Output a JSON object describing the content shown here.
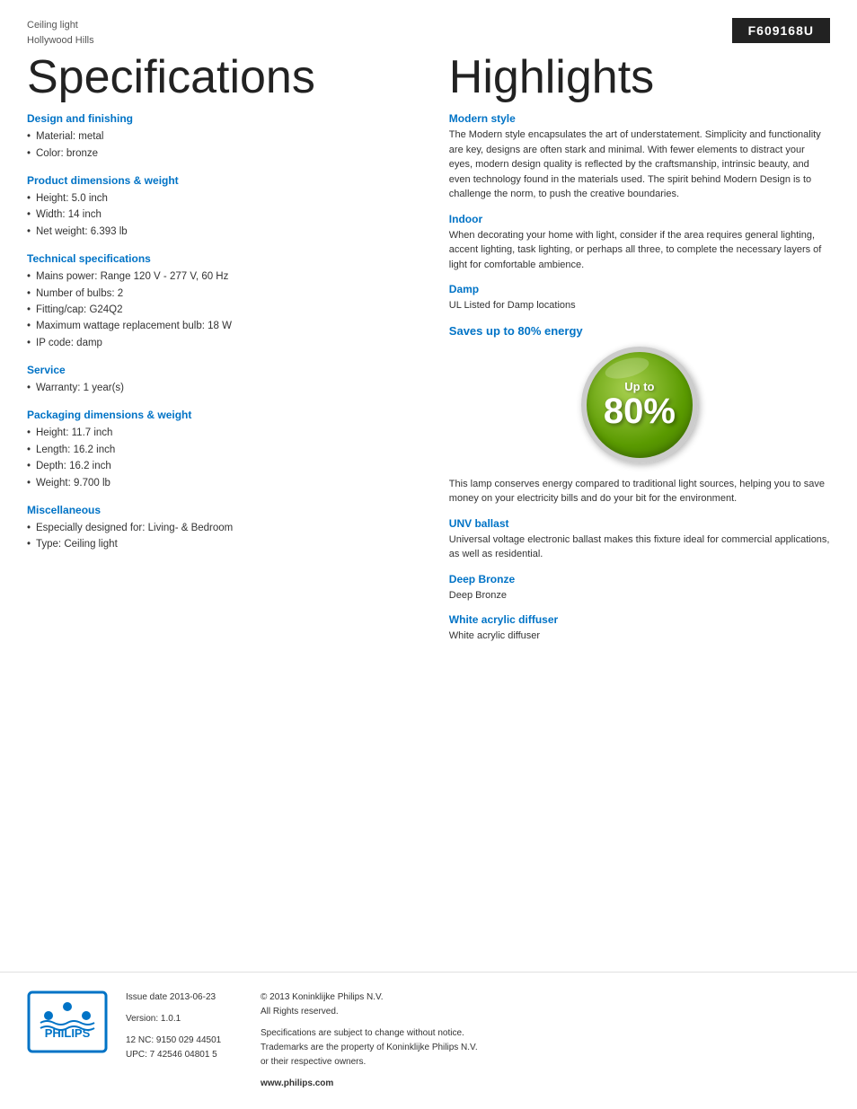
{
  "header": {
    "product_category": "Ceiling light",
    "product_name": "Hollywood Hills",
    "model_number": "F609168U"
  },
  "specs_page_title": "Specifications",
  "highlights_page_title": "Highlights",
  "sections": {
    "design": {
      "title": "Design and finishing",
      "items": [
        "Material: metal",
        "Color: bronze"
      ]
    },
    "product_dimensions": {
      "title": "Product dimensions & weight",
      "items": [
        "Height: 5.0 inch",
        "Width: 14 inch",
        "Net weight: 6.393 lb"
      ]
    },
    "technical": {
      "title": "Technical specifications",
      "items": [
        "Mains power: Range 120 V - 277 V, 60 Hz",
        "Number of bulbs: 2",
        "Fitting/cap: G24Q2",
        "Maximum wattage replacement bulb: 18 W",
        "IP code: damp"
      ]
    },
    "service": {
      "title": "Service",
      "items": [
        "Warranty: 1 year(s)"
      ]
    },
    "packaging": {
      "title": "Packaging dimensions & weight",
      "items": [
        "Height: 11.7 inch",
        "Length: 16.2 inch",
        "Depth: 16.2 inch",
        "Weight: 9.700 lb"
      ]
    },
    "miscellaneous": {
      "title": "Miscellaneous",
      "items": [
        "Especially designed for: Living- & Bedroom",
        "Type: Ceiling light"
      ]
    }
  },
  "highlights": {
    "modern_style": {
      "title": "Modern style",
      "text": "The Modern style encapsulates the art of understatement. Simplicity and functionality are key, designs are often stark and minimal. With fewer elements to distract your eyes, modern design quality is reflected by the craftsmanship, intrinsic beauty, and even technology found in the materials used. The spirit behind Modern Design is to challenge the norm, to push the creative boundaries."
    },
    "indoor": {
      "title": "Indoor",
      "text": "When decorating your home with light, consider if the area requires general lighting, accent lighting, task lighting, or perhaps all three, to complete the necessary layers of light for comfortable ambience."
    },
    "damp": {
      "title": "Damp",
      "text": "UL Listed for Damp locations"
    },
    "saves_energy": {
      "title": "Saves up to 80% energy",
      "badge_up_to": "Up to",
      "badge_percent": "80%"
    },
    "energy_text": "This lamp conserves energy compared to traditional light sources, helping you to save money on your electricity bills and do your bit for the environment.",
    "unv_ballast": {
      "title": "UNV ballast",
      "text": "Universal voltage electronic ballast makes this fixture ideal for commercial applications, as well as residential."
    },
    "deep_bronze": {
      "title": "Deep Bronze",
      "text": "Deep Bronze"
    },
    "white_diffuser": {
      "title": "White acrylic diffuser",
      "text": "White acrylic diffuser"
    }
  },
  "footer": {
    "issue_date_label": "Issue date 2013-06-23",
    "version_label": "Version: 1.0.1",
    "nc_upc": "12 NC: 9150 029 44501\nUPC: 7 42546 04801 5",
    "copyright": "© 2013 Koninklijke Philips N.V.\nAll Rights reserved.",
    "specs_notice": "Specifications are subject to change without notice.\nTrademarks are the property of Koninklijke Philips N.V.\nor their respective owners.",
    "website": "www.philips.com"
  }
}
